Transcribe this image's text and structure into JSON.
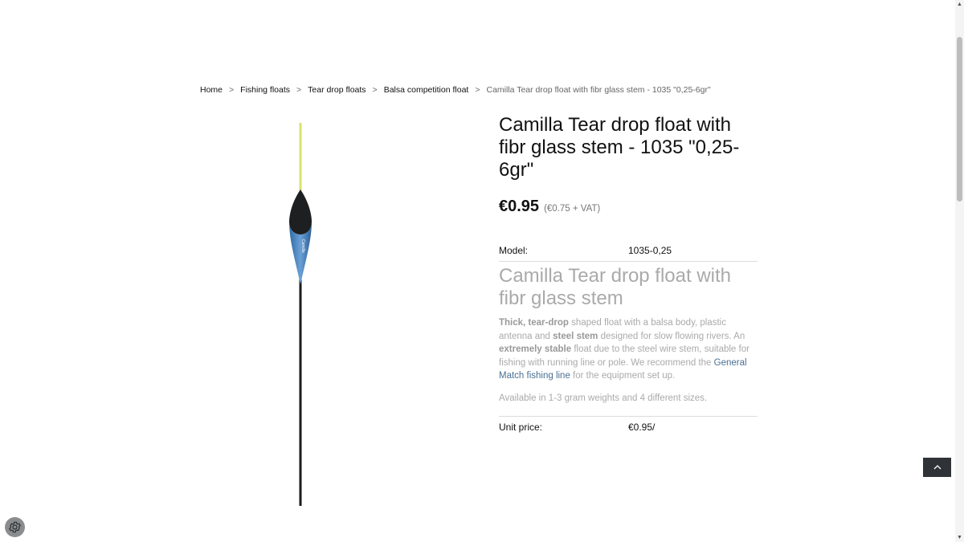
{
  "breadcrumb": {
    "separator": ">",
    "items": [
      "Home",
      "Fishing floats",
      "Tear drop floats",
      "Balsa competition float"
    ],
    "current": "Camilla Tear drop float with fibr glass stem - 1035 \"0,25-6gr\""
  },
  "product": {
    "title": "Camilla Tear drop float with fibr glass stem - 1035 \"0,25-6gr\"",
    "price": "€0.95",
    "price_ex_vat": "(€0.75 + VAT)",
    "model_label": "Model:",
    "model_value": "1035-0,25",
    "description_title": "Camilla Tear drop float with fibr glass stem",
    "description": {
      "b1": "Thick, tear-drop",
      "t1": " shaped float with a balsa body, plastic antenna and ",
      "b2": "steel stem",
      "t2": " designed for slow flowing rivers. An ",
      "b3": "extremely stable",
      "t3": " float due to the steel wire stem, suitable for fishing with running line or pole. We recommend the ",
      "link": "General Match fishing line",
      "t4": " for the equipment set up."
    },
    "availability": "Available in 1-3 gram weights and 4 different sizes.",
    "unit_price_label": "Unit price:",
    "unit_price_value": "€0.95/"
  },
  "image": {
    "float_brand": "Camilla"
  },
  "icons": {
    "back_to_top": "chevron-up-icon",
    "settings": "gear-icon"
  },
  "colors": {
    "link": "#4a6f93",
    "button_dark": "#2f3337",
    "antenna": "#d9e36b",
    "float_body": "#3f7fb8"
  }
}
